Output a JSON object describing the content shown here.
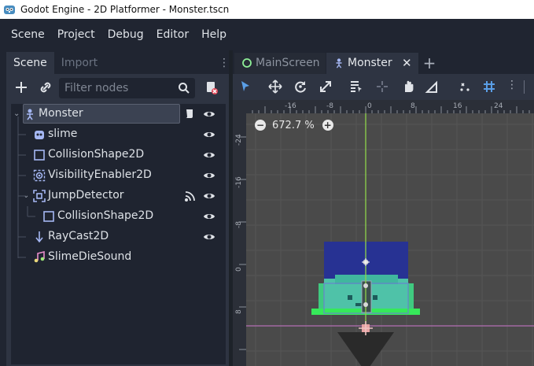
{
  "window": {
    "title": "Godot Engine - 2D Platformer - Monster.tscn",
    "icon": "godot-icon"
  },
  "menu": {
    "items": [
      "Scene",
      "Project",
      "Debug",
      "Editor",
      "Help"
    ]
  },
  "dock": {
    "tabs": [
      {
        "label": "Scene",
        "active": true
      },
      {
        "label": "Import",
        "active": false
      }
    ],
    "filter_placeholder": "Filter nodes",
    "tree": [
      {
        "label": "Monster",
        "icon": "kinematic-body-icon",
        "expanded": true,
        "selected": true,
        "has_script": true,
        "visible": true
      },
      {
        "label": "slime",
        "icon": "sprite-icon",
        "visible": true
      },
      {
        "label": "CollisionShape2D",
        "icon": "collision-shape-icon",
        "visible": true
      },
      {
        "label": "VisibilityEnabler2D",
        "icon": "visibility-enabler-icon",
        "visible": true
      },
      {
        "label": "JumpDetector",
        "icon": "area2d-icon",
        "expanded": true,
        "has_signal": true,
        "visible": true
      },
      {
        "label": "CollisionShape2D",
        "icon": "collision-shape-icon",
        "visible": true
      },
      {
        "label": "RayCast2D",
        "icon": "raycast-icon",
        "visible": true
      },
      {
        "label": "SlimeDieSound",
        "icon": "audio-player-icon",
        "visible": false
      }
    ]
  },
  "editor": {
    "tabs": [
      {
        "label": "MainScreen",
        "icon": "scene-circle-icon",
        "active": false
      },
      {
        "label": "Monster",
        "icon": "kinematic-body-icon",
        "active": true
      }
    ],
    "zoom": "672.7 %",
    "ruler_top_labels": [
      "-16",
      "-8",
      "0",
      "8",
      "16",
      "24"
    ],
    "ruler_left_labels": [
      "-24",
      "-16",
      "-8",
      "0",
      "8"
    ]
  },
  "colors": {
    "accent": "#5a9ee6",
    "background": "#202531",
    "panel": "#2e3442",
    "tree_bg": "#1f2430",
    "viewport": "#4a4a4a"
  }
}
